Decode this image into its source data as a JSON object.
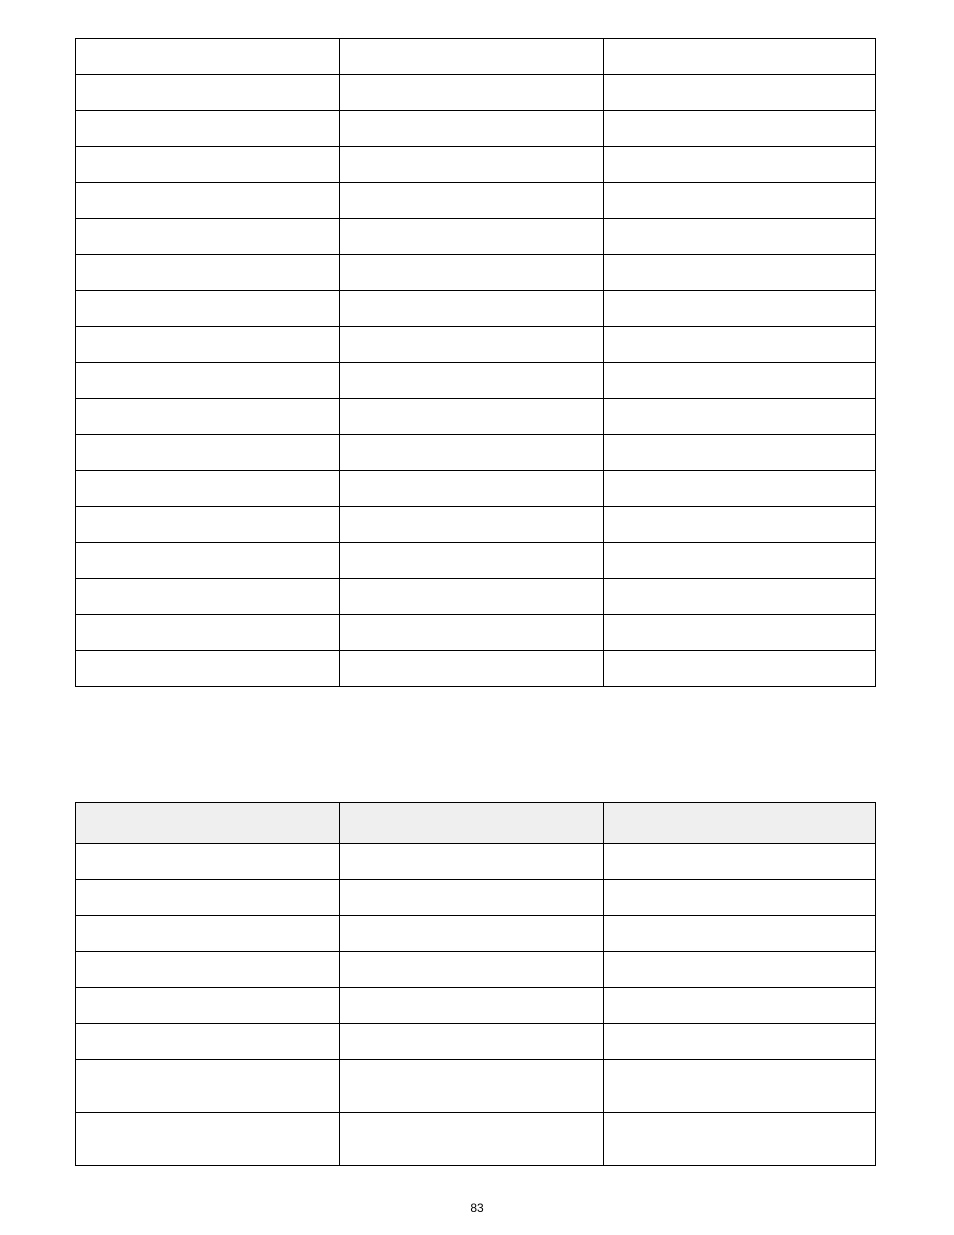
{
  "page_number": "83",
  "top_table": {
    "columns": 3,
    "col_widths_pct": [
      33,
      33,
      34
    ],
    "rows": [
      [
        "",
        "",
        ""
      ],
      [
        "",
        "",
        ""
      ],
      [
        "",
        "",
        ""
      ],
      [
        "",
        "",
        ""
      ],
      [
        "",
        "",
        ""
      ],
      [
        "",
        "",
        ""
      ],
      [
        "",
        "",
        ""
      ],
      [
        "",
        "",
        ""
      ],
      [
        "",
        "",
        ""
      ],
      [
        "",
        "",
        ""
      ],
      [
        "",
        "",
        ""
      ],
      [
        "",
        "",
        ""
      ],
      [
        "",
        "",
        ""
      ],
      [
        "",
        "",
        ""
      ],
      [
        "",
        "",
        ""
      ],
      [
        "",
        "",
        ""
      ],
      [
        "",
        "",
        ""
      ],
      [
        "",
        "",
        ""
      ]
    ]
  },
  "bottom_table": {
    "columns": 3,
    "col_widths_pct": [
      33,
      33,
      34
    ],
    "header": [
      "",
      "",
      ""
    ],
    "rows": [
      {
        "cells": [
          "",
          "",
          ""
        ],
        "size": "short"
      },
      {
        "cells": [
          "",
          "",
          ""
        ],
        "size": "short"
      },
      {
        "cells": [
          "",
          "",
          ""
        ],
        "size": "short"
      },
      {
        "cells": [
          "",
          "",
          ""
        ],
        "size": "short"
      },
      {
        "cells": [
          "",
          "",
          ""
        ],
        "size": "short"
      },
      {
        "cells": [
          "",
          "",
          ""
        ],
        "size": "short"
      },
      {
        "cells": [
          "",
          "",
          ""
        ],
        "size": "tall"
      },
      {
        "cells": [
          "",
          "",
          ""
        ],
        "size": "tall"
      }
    ]
  }
}
